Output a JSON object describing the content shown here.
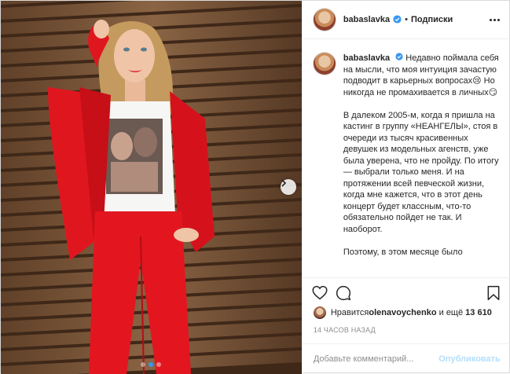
{
  "post": {
    "username": "babaslavka",
    "separator": "•",
    "follow_label": "Подписки",
    "caption_paragraphs": [
      "Недавно поймала себя на мысли, что моя интуиция зачастую подводит в карьерных вопросах😢 Но никогда не промахивается в личных😏",
      "В далеком 2005-м, когда я пришла на кастинг в группу «НЕАНГЕЛЫ», стоя в очереди из тысяч красивенных девушек из модельных агенств, уже была уверена, что не пройду. По итогу — выбрали только меня. И на протяжении всей певческой жизни, когда мне кажется, что в этот день концерт будет классным, что-то обязательно пойдет не так. И наоборот.",
      "Поэтому, в этом месяце было"
    ],
    "likes": {
      "prefix": "Нравится ",
      "user": "olenavoychenko",
      "middle": " и ещё ",
      "count": "13 610"
    },
    "timestamp": "14 ЧАСОВ НАЗАД",
    "comment_placeholder": "Добавьте комментарий...",
    "publish_label": "Опубликовать",
    "carousel": {
      "slides": 3,
      "active": 1
    }
  },
  "icons": {
    "verified": "verified-badge-icon",
    "like": "heart-icon",
    "comment": "comment-icon",
    "save": "bookmark-icon",
    "next": "chevron-right-icon",
    "more": "more-options-icon"
  },
  "colors": {
    "accent": "#3897f0",
    "publish_disabled": "#b2dffc",
    "suit": "#e0161f",
    "wall": "#7a5638"
  }
}
